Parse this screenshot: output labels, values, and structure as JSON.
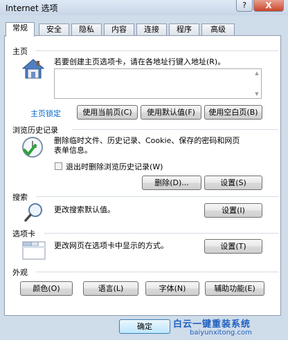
{
  "window": {
    "title": "Internet 选项",
    "help_label": "?",
    "close_label": "X"
  },
  "tabs": [
    {
      "label": "常规",
      "active": true
    },
    {
      "label": "安全"
    },
    {
      "label": "隐私"
    },
    {
      "label": "内容"
    },
    {
      "label": "连接"
    },
    {
      "label": "程序"
    },
    {
      "label": "高级"
    }
  ],
  "homepage": {
    "section_label": "主页",
    "description": "若要创建主页选项卡，请在各地址行键入地址(R)。",
    "address_value": "",
    "lock_link": "主页锁定",
    "use_current_label": "使用当前页(C)",
    "use_default_label": "使用默认值(F)",
    "use_blank_label": "使用空白页(B)"
  },
  "history": {
    "section_label": "浏览历史记录",
    "description_line1": "删除临时文件、历史记录、Cookie、保存的密码和网页",
    "description_line2": "表单信息。",
    "delete_on_exit_label": "退出时删除浏览历史记录(W)",
    "delete_on_exit_checked": false,
    "delete_label": "删除(D)...",
    "settings_label": "设置(S)"
  },
  "search": {
    "section_label": "搜索",
    "description": "更改搜索默认值。",
    "settings_label": "设置(I)"
  },
  "tabs_section": {
    "section_label": "选项卡",
    "description": "更改网页在选项卡中显示的方式。",
    "settings_label": "设置(T)"
  },
  "appearance": {
    "section_label": "外观",
    "colors_label": "颜色(O)",
    "languages_label": "语言(L)",
    "fonts_label": "字体(N)",
    "accessibility_label": "辅助功能(E)"
  },
  "footer": {
    "ok_label": "确定"
  },
  "watermark": {
    "line1": "白云一键重装系统",
    "line2": "baiyunxitong.com"
  }
}
